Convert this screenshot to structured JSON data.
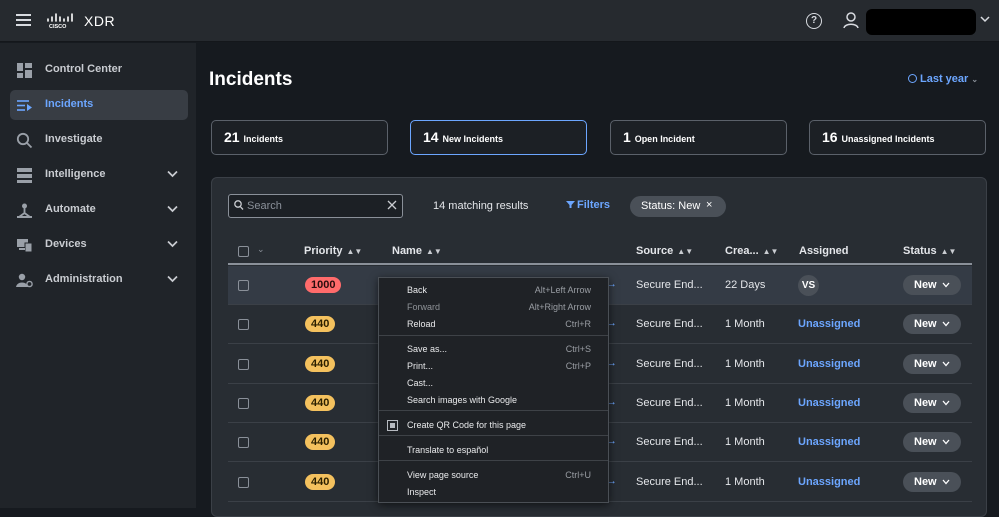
{
  "app": {
    "brand": "XDR"
  },
  "header": {
    "help_glyph": "?"
  },
  "sidebar": {
    "items": [
      {
        "label": "Control Center",
        "icon": "dashboard-icon",
        "chevron": false,
        "active": false
      },
      {
        "label": "Incidents",
        "icon": "incidents-icon",
        "chevron": false,
        "active": true
      },
      {
        "label": "Investigate",
        "icon": "search-icon",
        "chevron": false,
        "active": false
      },
      {
        "label": "Intelligence",
        "icon": "intelligence-icon",
        "chevron": true,
        "active": false
      },
      {
        "label": "Automate",
        "icon": "automate-icon",
        "chevron": true,
        "active": false
      },
      {
        "label": "Devices",
        "icon": "devices-icon",
        "chevron": true,
        "active": false
      },
      {
        "label": "Administration",
        "icon": "administration-icon",
        "chevron": true,
        "active": false
      }
    ]
  },
  "page": {
    "title": "Incidents",
    "period": "Last year"
  },
  "cards": [
    {
      "num": "21",
      "label": "Incidents"
    },
    {
      "num": "14",
      "label": "New Incidents"
    },
    {
      "num": "1",
      "label": "Open Incident"
    },
    {
      "num": "16",
      "label": "Unassigned Incidents"
    }
  ],
  "toolbar": {
    "search_placeholder": "Search",
    "results": "14 matching results",
    "filters": "Filters",
    "chip": "Status: New"
  },
  "table": {
    "columns": {
      "priority": "Priority",
      "name": "Name",
      "source": "Source",
      "created": "Crea...",
      "assigned": "Assigned",
      "status": "Status"
    },
    "rows": [
      {
        "priority": "1000",
        "level": "red",
        "source": "Secure End...",
        "created": "22 Days",
        "assigned": "VS",
        "avatar": true,
        "status": "New"
      },
      {
        "priority": "440",
        "level": "yel",
        "source": "Secure End...",
        "created": "1 Month",
        "assigned": "Unassigned",
        "avatar": false,
        "status": "New"
      },
      {
        "priority": "440",
        "level": "yel",
        "source": "Secure End...",
        "created": "1 Month",
        "assigned": "Unassigned",
        "avatar": false,
        "status": "New"
      },
      {
        "priority": "440",
        "level": "yel",
        "source": "Secure End...",
        "created": "1 Month",
        "assigned": "Unassigned",
        "avatar": false,
        "status": "New"
      },
      {
        "priority": "440",
        "level": "yel",
        "source": "Secure End...",
        "created": "1 Month",
        "assigned": "Unassigned",
        "avatar": false,
        "status": "New"
      },
      {
        "priority": "440",
        "level": "yel",
        "source": "Secure End...",
        "created": "1 Month",
        "assigned": "Unassigned",
        "avatar": false,
        "status": "New"
      }
    ]
  },
  "context_menu": {
    "items": [
      {
        "label": "Back",
        "shortcut": "Alt+Left Arrow"
      },
      {
        "label": "Forward",
        "shortcut": "Alt+Right Arrow",
        "disabled": true
      },
      {
        "label": "Reload",
        "shortcut": "Ctrl+R"
      },
      {
        "label": "Save as...",
        "shortcut": "Ctrl+S"
      },
      {
        "label": "Print...",
        "shortcut": "Ctrl+P"
      },
      {
        "label": "Cast...",
        "shortcut": ""
      },
      {
        "label": "Search images with Google",
        "shortcut": ""
      },
      {
        "label": "Create QR Code for this page",
        "shortcut": "",
        "icon": true
      },
      {
        "label": "Translate to español",
        "shortcut": ""
      },
      {
        "label": "View page source",
        "shortcut": "Ctrl+U"
      },
      {
        "label": "Inspect",
        "shortcut": ""
      }
    ]
  },
  "colors": {
    "accent": "#6ca6ff",
    "critical": "#ff6b6b",
    "warning": "#f4c15e"
  }
}
